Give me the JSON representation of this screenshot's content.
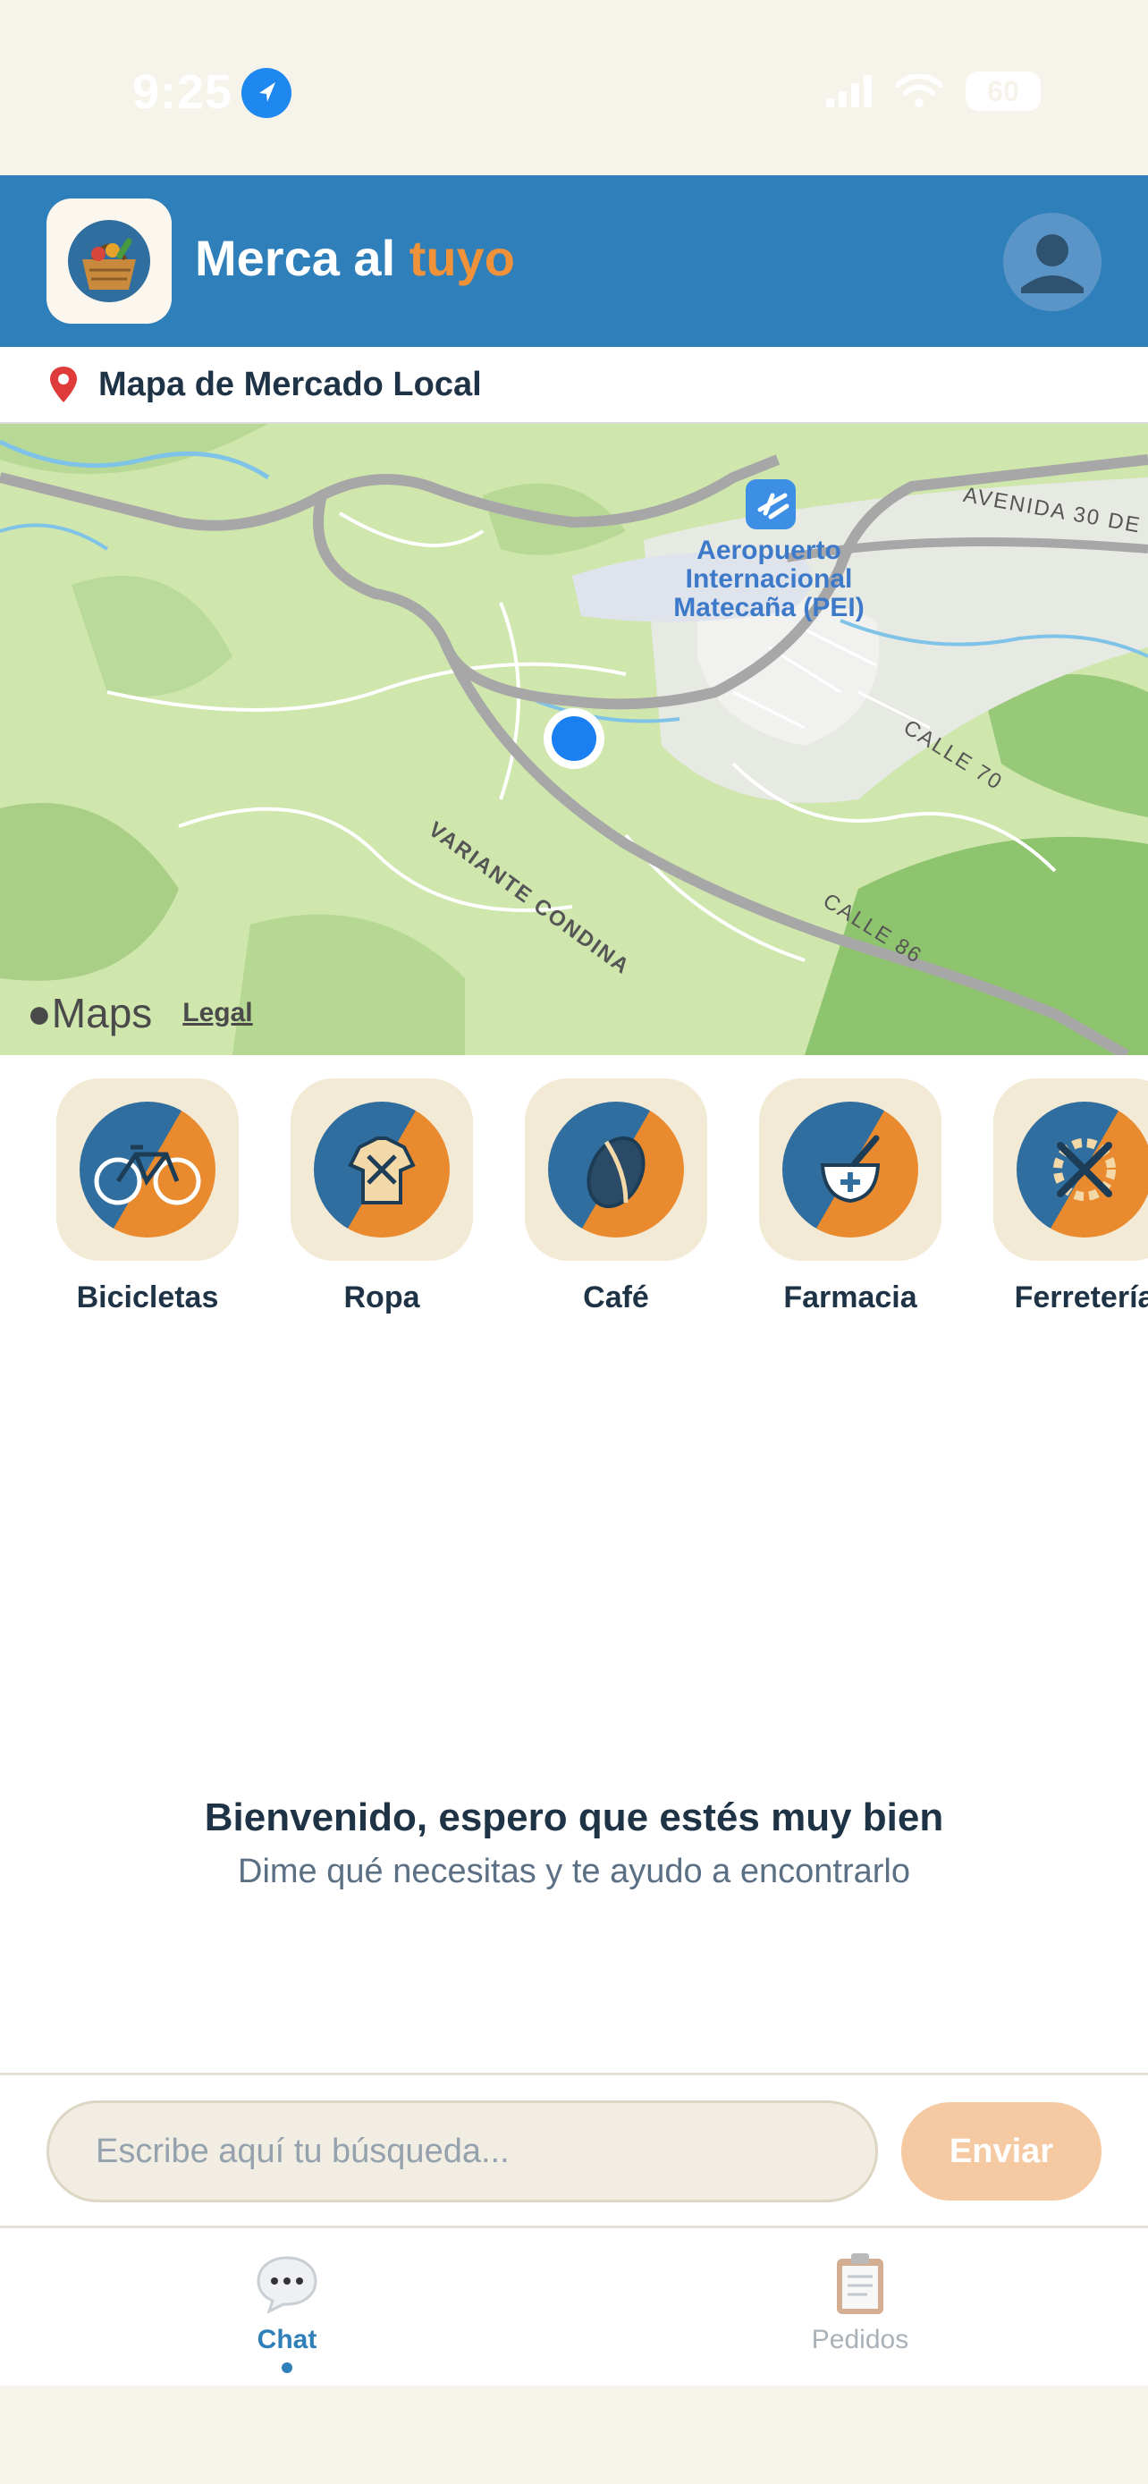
{
  "status_bar": {
    "time": "9:25",
    "battery": "60",
    "icons": [
      "location-arrow-icon",
      "cellular-signal-icon",
      "wifi-icon",
      "battery-icon"
    ]
  },
  "header": {
    "title_main": "Merca al ",
    "title_accent": "tuyo",
    "colors": {
      "bar": "#2f7fba",
      "accent": "#f0923a"
    }
  },
  "map_section": {
    "label": "Mapa de Mercado Local",
    "map_labels": {
      "airport": [
        "Aeropuerto",
        "Internacional",
        "Matecaña (PEI)"
      ],
      "road_variante": "VARIANTE CONDINA",
      "road_avenida": "AVENIDA 30 DE",
      "road_calle70": "CALLE 70",
      "road_calle86": "CALLE 86"
    },
    "attribution": {
      "brand": "Maps",
      "legal": "Legal"
    }
  },
  "categories": [
    {
      "label": "Bicicletas",
      "icon": "bicycle-icon"
    },
    {
      "label": "Ropa",
      "icon": "clothing-icon"
    },
    {
      "label": "Café",
      "icon": "coffee-bean-icon"
    },
    {
      "label": "Farmacia",
      "icon": "pharmacy-icon"
    },
    {
      "label": "Ferretería",
      "icon": "hardware-tools-icon"
    }
  ],
  "chat": {
    "welcome_title": "Bienvenido, espero que estés muy bien",
    "welcome_subtitle": "Dime qué necesitas y te ayudo a encontrarlo"
  },
  "composer": {
    "placeholder": "Escribe aquí tu búsqueda...",
    "value": "",
    "send_label": "Enviar"
  },
  "tabs": [
    {
      "label": "Chat",
      "icon": "chat-bubble-icon",
      "active": true
    },
    {
      "label": "Pedidos",
      "icon": "clipboard-icon",
      "active": false
    }
  ]
}
